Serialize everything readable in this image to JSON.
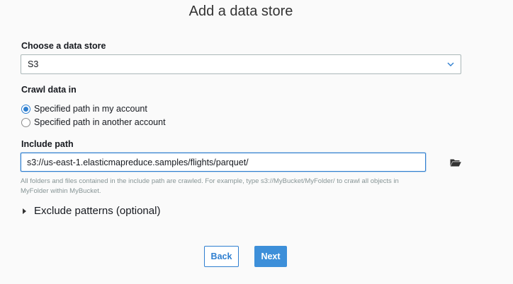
{
  "page": {
    "title": "Add a data store"
  },
  "data_store": {
    "label": "Choose a data store",
    "selected": "S3",
    "chevron_icon": "chevron-down-icon"
  },
  "crawl": {
    "label": "Crawl data in",
    "options": [
      {
        "label": "Specified path in my account",
        "checked": true
      },
      {
        "label": "Specified path in another account",
        "checked": false
      }
    ]
  },
  "include_path": {
    "label": "Include path",
    "value": "s3://us-east-1.elasticmapreduce.samples/flights/parquet/",
    "browse_icon": "folder-open-icon",
    "help_line1": "All folders and files contained in the include path are crawled. For example, type s3://MyBucket/MyFolder/ to crawl all objects in",
    "help_line2": "MyFolder within MyBucket."
  },
  "exclude": {
    "label": "Exclude patterns (optional)",
    "expanded": false
  },
  "actions": {
    "back_label": "Back",
    "next_label": "Next"
  },
  "colors": {
    "accent": "#2f7fd0",
    "primary_button": "#3d8fd9",
    "help_text": "#879596"
  }
}
